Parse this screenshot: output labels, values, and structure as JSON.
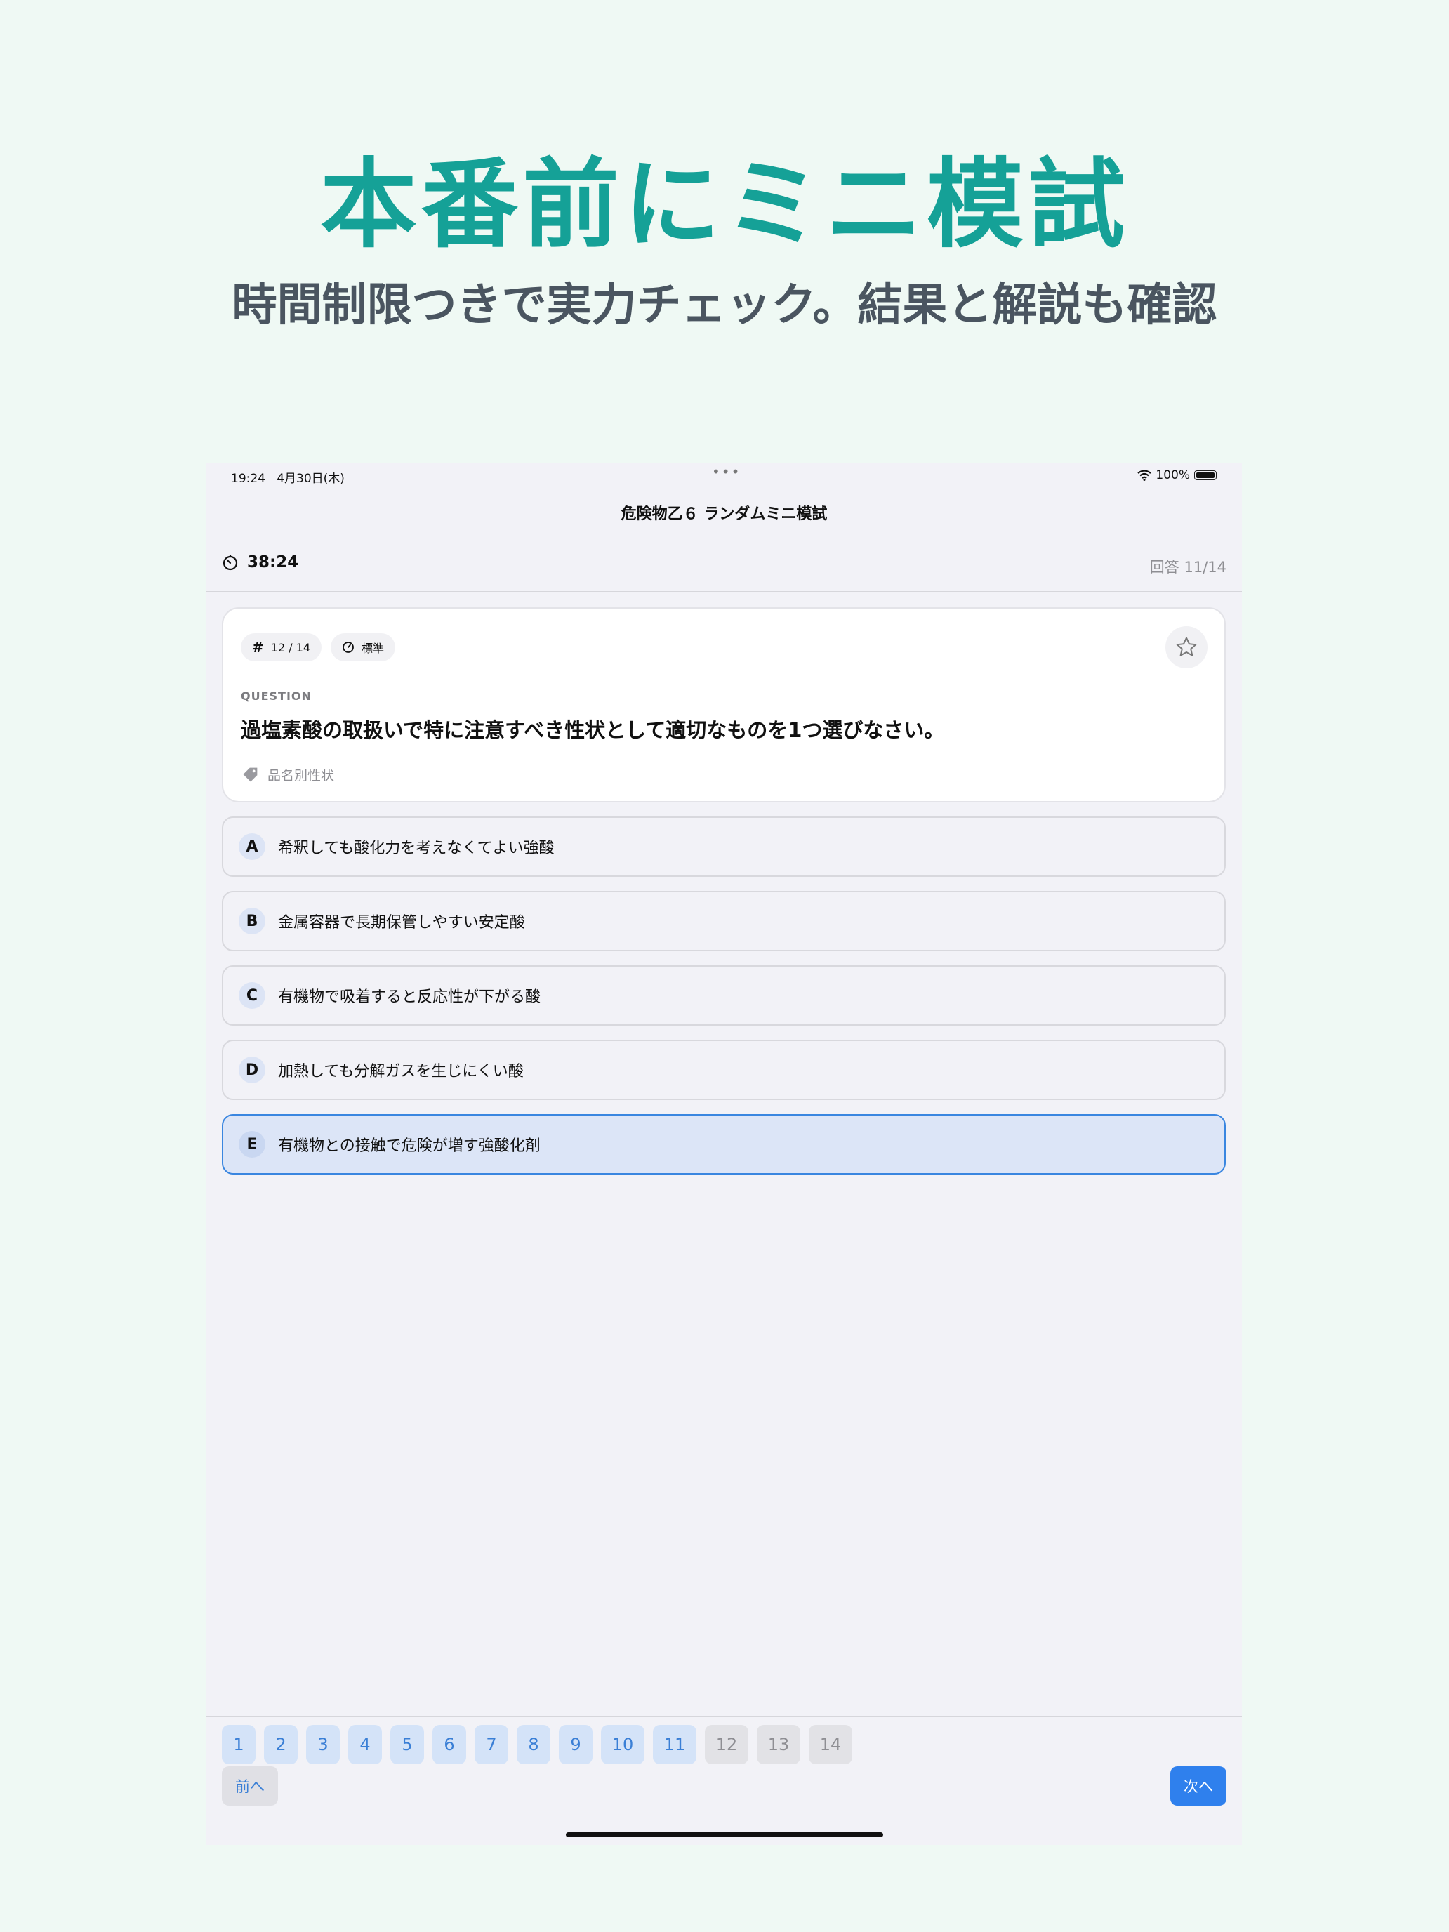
{
  "promo": {
    "headline": "本番前にミニ模試",
    "subhead": "時間制限つきで実力チェック。結果と解説も確認"
  },
  "status_bar": {
    "time": "19:24",
    "date": "4月30日(木)",
    "dots": "•••",
    "battery": "100%"
  },
  "nav": {
    "title": "危険物乙６ ランダムミニ模試"
  },
  "timer": {
    "remaining": "38:24"
  },
  "progress": {
    "answered": "回答 11/14"
  },
  "question": {
    "number_chip": "12 / 14",
    "difficulty_chip": "標準",
    "label": "QUESTION",
    "text": "過塩素酸の取扱いで特に注意すべき性状として適切なものを1つ選びなさい。",
    "tag": "品名別性状",
    "starred": false
  },
  "options": [
    {
      "letter": "A",
      "text": "希釈しても酸化力を考えなくてよい強酸",
      "selected": false
    },
    {
      "letter": "B",
      "text": "金属容器で長期保管しやすい安定酸",
      "selected": false
    },
    {
      "letter": "C",
      "text": "有機物で吸着すると反応性が下がる酸",
      "selected": false
    },
    {
      "letter": "D",
      "text": "加熱しても分解ガスを生じにくい酸",
      "selected": false
    },
    {
      "letter": "E",
      "text": "有機物との接触で危険が増す強酸化剤",
      "selected": true
    }
  ],
  "pager": [
    "1",
    "2",
    "3",
    "4",
    "5",
    "6",
    "7",
    "8",
    "9",
    "10",
    "11",
    "12",
    "13",
    "14"
  ],
  "buttons": {
    "prev": "前へ",
    "next": "次へ"
  },
  "colors": {
    "accent": "#2f80ed",
    "headline": "#15a197",
    "selected_bg": "#dce5f7"
  }
}
